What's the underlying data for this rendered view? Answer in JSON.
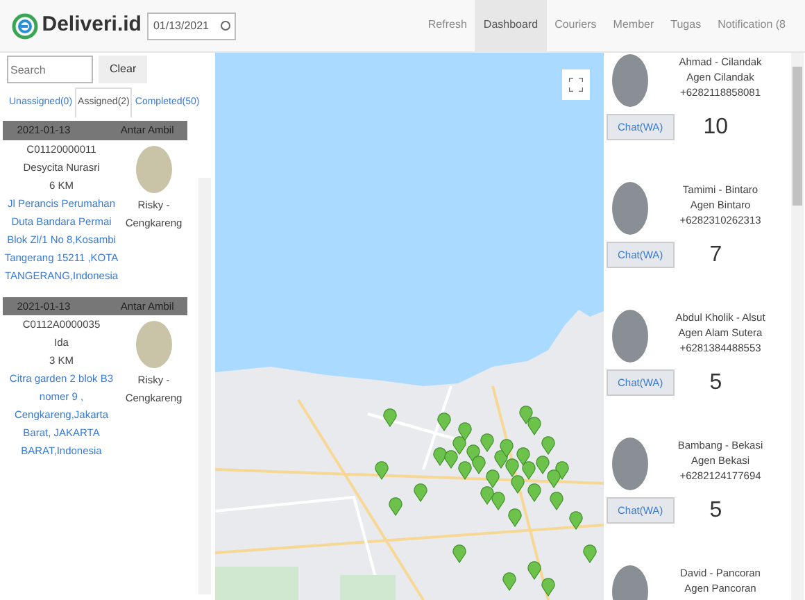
{
  "brand": {
    "name": "Deliveri.id"
  },
  "date_field": {
    "value": "01/13/2021"
  },
  "nav": [
    {
      "label": "Refresh",
      "selected": false
    },
    {
      "label": "Dashboard",
      "selected": true
    },
    {
      "label": "Couriers",
      "selected": false
    },
    {
      "label": "Member",
      "selected": false
    },
    {
      "label": "Tugas",
      "selected": false
    },
    {
      "label": "Notification (8",
      "selected": false
    }
  ],
  "search": {
    "placeholder": "Search",
    "button": "Clear"
  },
  "tabs": [
    {
      "label": "Unassigned(0)",
      "selected": false
    },
    {
      "label": "Assigned(2)",
      "selected": true
    },
    {
      "label": "Completed(50)",
      "selected": false
    }
  ],
  "orders": [
    {
      "date": "2021-01-13",
      "type": "Antar Ambil",
      "code": "C01120000011",
      "customer": "Desycita Nurasri",
      "distance": "6 KM",
      "address": "Jl Perancis Perumahan Duta Bandara Permai Blok Zl/1 No 8,Kosambi Tangerang 15211 ,KOTA TANGERANG,Indonesia",
      "courier": "Risky - Cengkareng"
    },
    {
      "date": "2021-01-13",
      "type": "Antar Ambil",
      "code": "C0112A0000035",
      "customer": "Ida",
      "distance": "3 KM",
      "address": "Citra garden 2 blok B3 nomer 9 , Cengkareng,Jakarta Barat, JAKARTA BARAT,Indonesia",
      "courier": "Risky - Cengkareng"
    }
  ],
  "couriers": [
    {
      "name": "Ahmad - Cilandak",
      "agent": "Agen Cilandak",
      "phone": "+6282118858081",
      "button": "Chat(WA)",
      "count": "10"
    },
    {
      "name": "Tamimi - Bintaro",
      "agent": "Agen Bintaro",
      "phone": "+6282310262313",
      "button": "Chat(WA)",
      "count": "7"
    },
    {
      "name": "Abdul Kholik - Alsut",
      "agent": "Agen Alam Sutera",
      "phone": "+6281384488553",
      "button": "Chat(WA)",
      "count": "5"
    },
    {
      "name": "Bambang - Bekasi",
      "agent": "Agen Bekasi",
      "phone": "+6282124177694",
      "button": "Chat(WA)",
      "count": "5"
    },
    {
      "name": "David - Pancoran",
      "agent": "Agen Pancoran"
    }
  ]
}
